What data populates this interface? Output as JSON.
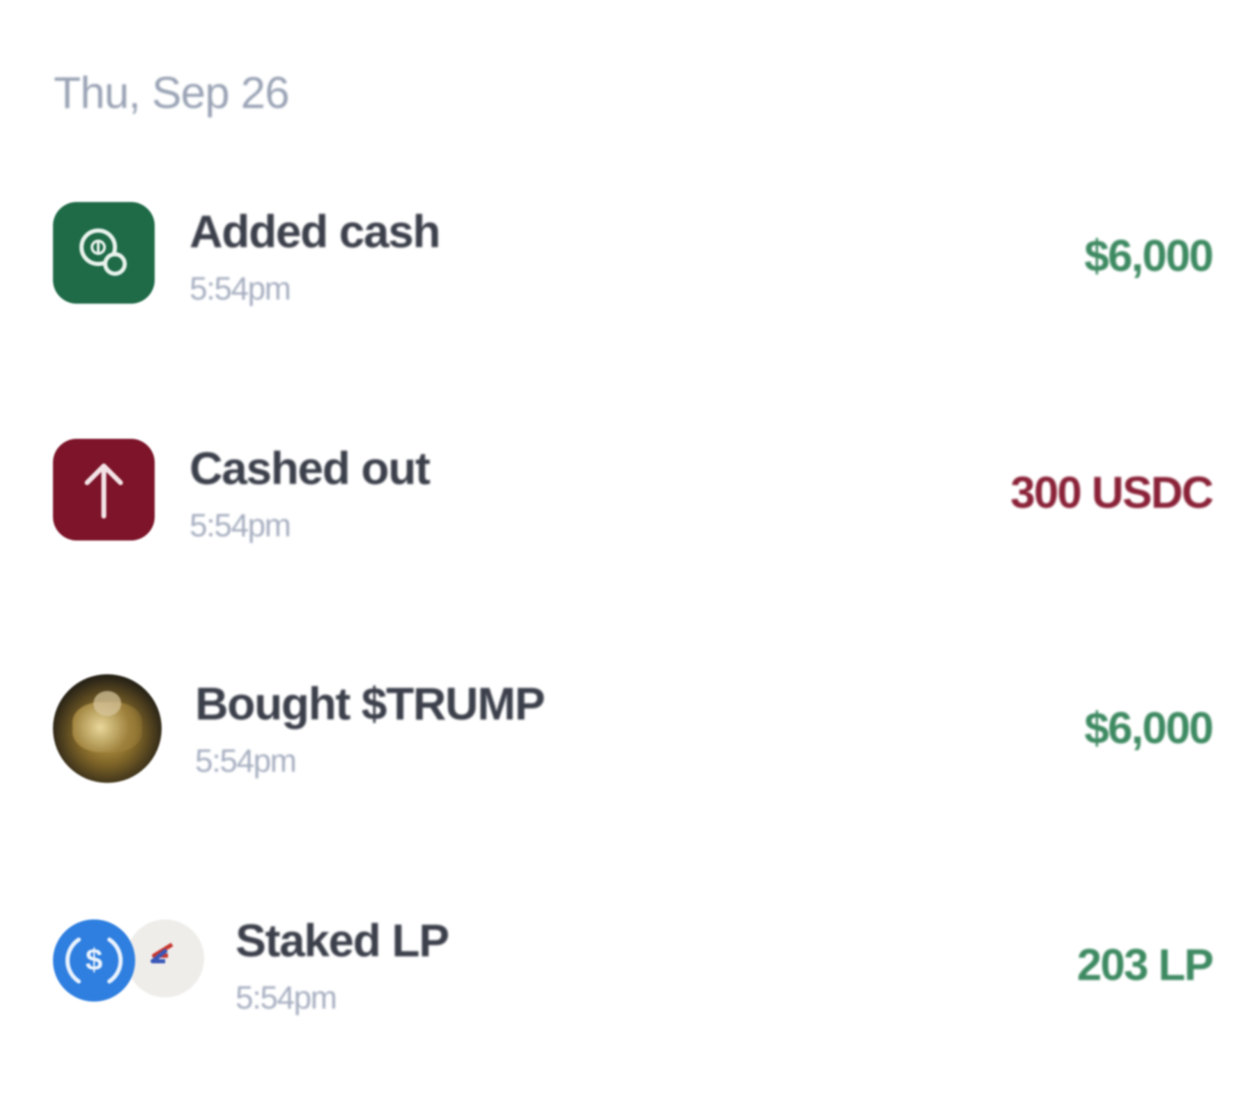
{
  "date_heading": "Thu, Sep 26",
  "colors": {
    "positive": "#3e8a62",
    "negative": "#8a2238",
    "added_cash_tile": "#1f6b48",
    "cashed_out_tile": "#7d1429",
    "usdc_blue": "#2f7fe0"
  },
  "transactions": [
    {
      "title": "Added cash",
      "time": "5:54pm",
      "amount": "$6,000",
      "amount_tone": "positive",
      "icon": "coins-icon"
    },
    {
      "title": "Cashed out",
      "time": "5:54pm",
      "amount": "300 USDC",
      "amount_tone": "negative",
      "icon": "arrow-up-icon"
    },
    {
      "title": "Bought $TRUMP",
      "time": "5:54pm",
      "amount": "$6,000",
      "amount_tone": "positive",
      "icon": "trump-token-icon"
    },
    {
      "title": "Staked LP",
      "time": "5:54pm",
      "amount": "203 LP",
      "amount_tone": "positive",
      "icon": "usdc-lp-pair-icon"
    }
  ]
}
